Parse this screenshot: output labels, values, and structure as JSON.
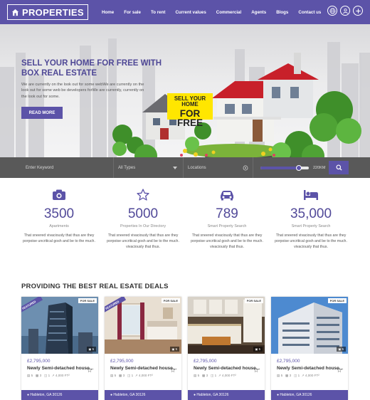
{
  "header": {
    "logo_text": "PROPERTIES",
    "menu": [
      "Home",
      "For sale",
      "To rent",
      "Current values",
      "Commercial",
      "Agents",
      "Blogs",
      "Contact us"
    ]
  },
  "hero": {
    "title": "SELL YOUR HOME FOR FREE WITH BOX REAL ESTATE",
    "description": "We are currently on the look out for some webWe are currently on the look out for some web be developers forWe are currently, currently on the look out for some.",
    "button": "READ MORE",
    "banner_line1": "SELL YOUR HOME",
    "banner_line2": "FOR FREE"
  },
  "search": {
    "keyword_placeholder": "Enter Keyword",
    "type_value": "All Types",
    "location_placeholder": "Locations",
    "range_label": "220KM",
    "range_fraction": 0.8
  },
  "stats": [
    {
      "icon": "camera-icon",
      "number": "3500",
      "label": "Apartments",
      "desc": "That sneered vivaciously that thus are they porpoise uncritical gosh and be to the much."
    },
    {
      "icon": "star-icon",
      "number": "5000",
      "label": "Properties In Our Directory",
      "desc": "That sneered vivaciously that thus are they porpoise uncritical gosh and be to the much. vivaciously that thus."
    },
    {
      "icon": "car-icon",
      "number": "789",
      "label": "Smart Property Search",
      "desc": "That sneered vivaciously that thus are they porpoise uncritical gosh and be to the much. vivaciously that thus."
    },
    {
      "icon": "bed-icon",
      "number": "35,000",
      "label": "Smart Property Search",
      "desc": "That sneered vivaciously that thus are they porpoise uncritical gosh and be to the much. vivaciously that thus."
    }
  ],
  "section_title": "PROVIDING THE BEST REAL ESATE DEALS",
  "listings": [
    {
      "featured": "FEATURED",
      "sale": "FOR SALE",
      "photos": "5",
      "price": "£2,795,000",
      "title": "Newly Semi-detached house...",
      "beds": "5",
      "baths": "3",
      "cars": "1",
      "area": "4,000 FT²",
      "location": "Hableton, GA 30126"
    },
    {
      "featured": "FEATURED",
      "sale": "FOR SALE",
      "photos": "5",
      "price": "£2,795,000",
      "title": "Newly Semi-detached house...",
      "beds": "5",
      "baths": "3",
      "cars": "1",
      "area": "4,000 FT²",
      "location": "Hableton, GA 30126"
    },
    {
      "featured": "",
      "sale": "FOR SALE",
      "photos": "5",
      "price": "£2,795,000",
      "title": "Newly Semi-detached house...",
      "beds": "5",
      "baths": "3",
      "cars": "1",
      "area": "4,000 FT²",
      "location": "Hableton, GA 30126"
    },
    {
      "featured": "",
      "sale": "FOR SALE",
      "photos": "5",
      "price": "£2,795,000",
      "title": "Newly Semi-detached house...",
      "beds": "5",
      "baths": "3",
      "cars": "1",
      "area": "4,000 FT²",
      "location": "Hableton, GA 30126"
    }
  ],
  "colors": {
    "brand": "#5c53a8",
    "banner": "#ffe600",
    "search_bg": "#595959"
  }
}
